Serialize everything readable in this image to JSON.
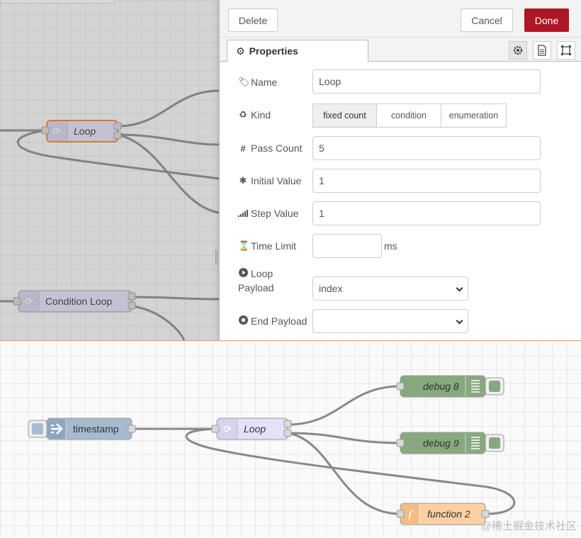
{
  "tray": {
    "toolbar": {
      "delete_label": "Delete",
      "cancel_label": "Cancel",
      "done_label": "Done"
    },
    "tab": {
      "label": "Properties",
      "icon": "gear-icon"
    },
    "tab_icons": [
      "gear-icon",
      "description-icon",
      "appearance-icon"
    ],
    "fields": {
      "name": {
        "label": "Name",
        "icon": "tag-icon",
        "value": "Loop"
      },
      "kind": {
        "label": "Kind",
        "icon": "recycle-icon",
        "options": [
          "fixed count",
          "condition",
          "enumeration"
        ],
        "selected": "fixed count"
      },
      "pass_count": {
        "label": "Pass Count",
        "icon": "hash-icon",
        "value": "5"
      },
      "initial_value": {
        "label": "Initial Value",
        "icon": "asterisk-icon",
        "value": "1"
      },
      "step_value": {
        "label": "Step Value",
        "icon": "signal-icon",
        "value": "1"
      },
      "time_limit": {
        "label": "Time Limit",
        "icon": "hourglass-icon",
        "value": "",
        "unit": "ms"
      },
      "loop_payload": {
        "label_line1": "Loop",
        "label_line2": "Payload",
        "icon": "play-circle-icon",
        "value": "index"
      },
      "end_payload": {
        "label": "End Payload",
        "icon": "circle-icon",
        "value": ""
      }
    }
  },
  "top_nodes": {
    "loop": "Loop",
    "condition_loop": "Condition Loop"
  },
  "bottom_nodes": {
    "inject": "timestamp",
    "loop": "Loop",
    "debug8": "debug 8",
    "debug9": "debug 9",
    "function2": "function 2"
  },
  "watermark": "@稀土掘金技术社区",
  "colors": {
    "done": "#ad1625",
    "inject": "#a6bbcf",
    "loop": "#e6e0f8",
    "debug": "#87a980",
    "function": "#fdd0a2"
  }
}
